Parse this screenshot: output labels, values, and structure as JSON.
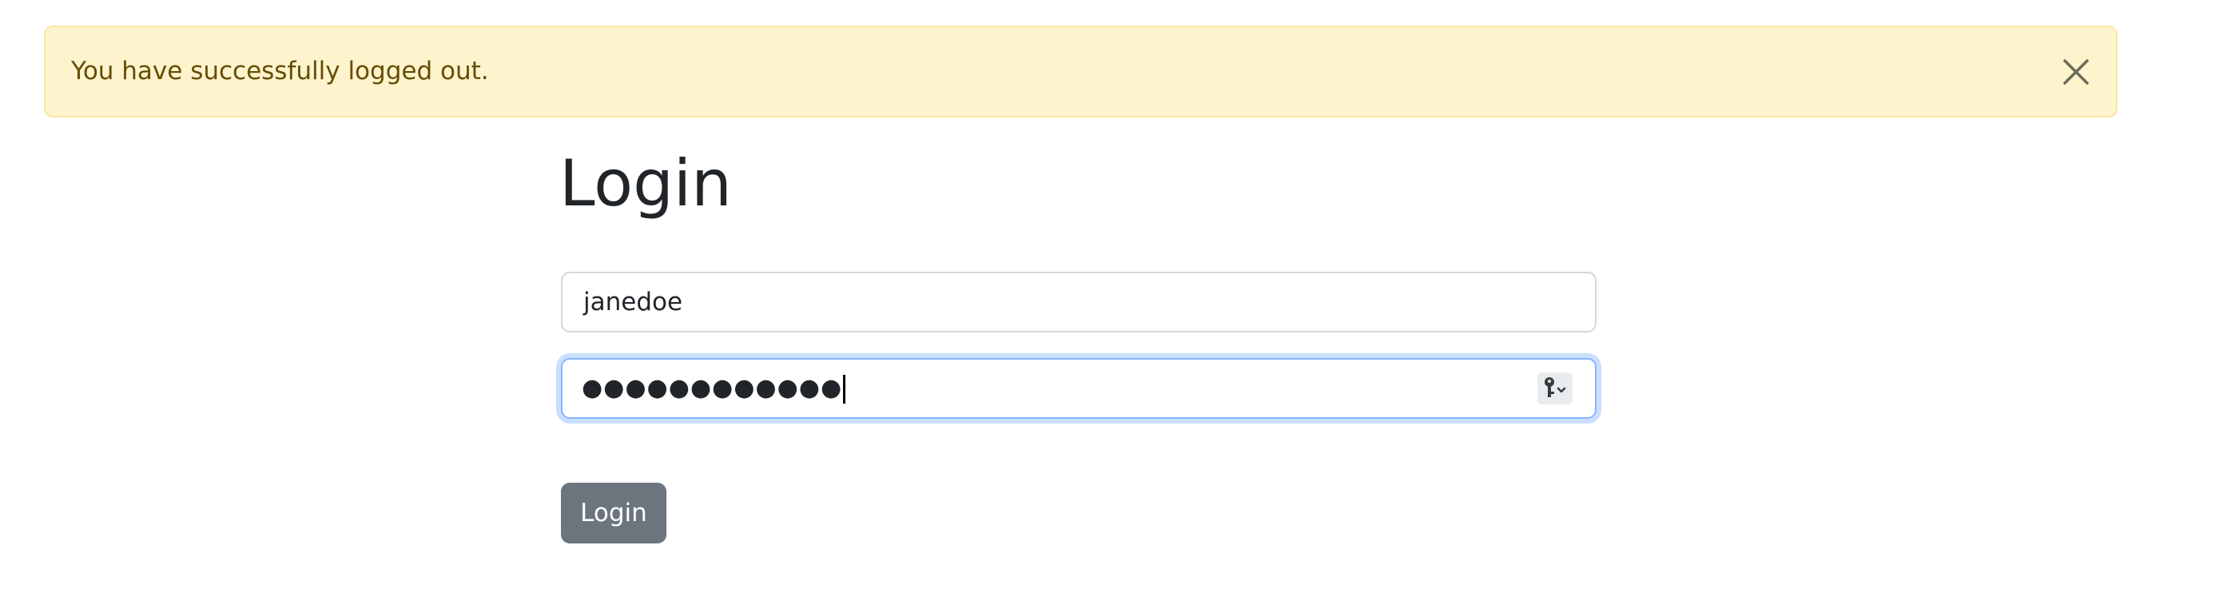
{
  "alert": {
    "message": "You have successfully logged out.",
    "close_icon": "close-icon",
    "background_color": "#fdf3cd",
    "text_color": "#664d03"
  },
  "login": {
    "title": "Login",
    "username_value": "janedoe",
    "password_masked": "●●●●●●●●●●●●",
    "password_manager_icon": "key-icon",
    "submit_label": "Login",
    "submit_color": "#6c757d",
    "focus_color": "#86b7fe"
  }
}
